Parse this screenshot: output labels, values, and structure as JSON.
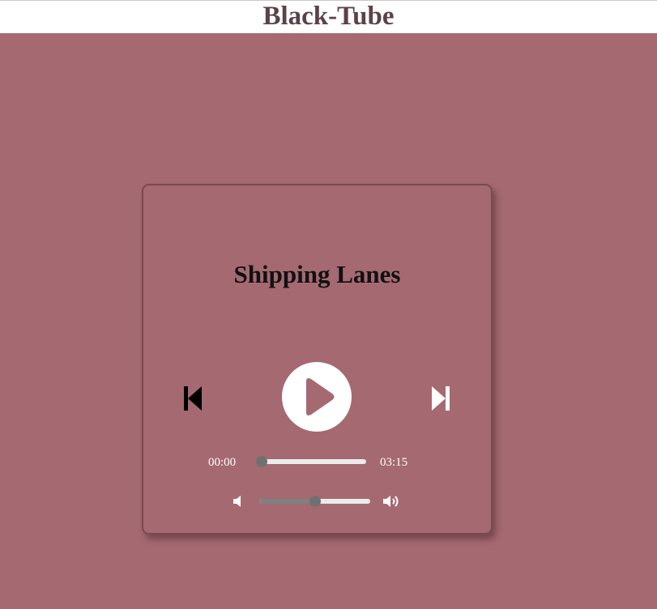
{
  "header": {
    "title": "Black-Tube"
  },
  "player": {
    "track_title": "Shipping Lanes",
    "current_time": "00:00",
    "total_time": "03:15",
    "progress": 0.0,
    "volume": 0.5,
    "icons": {
      "previous": "skip-previous-icon",
      "play": "play-icon",
      "next": "skip-next-icon",
      "volume_low": "volume-low-icon",
      "volume_high": "volume-high-icon"
    }
  },
  "colors": {
    "background": "#a56972",
    "header_title": "#5b4248",
    "card_border": "#7a4a52",
    "play_triangle": "#a56972"
  }
}
